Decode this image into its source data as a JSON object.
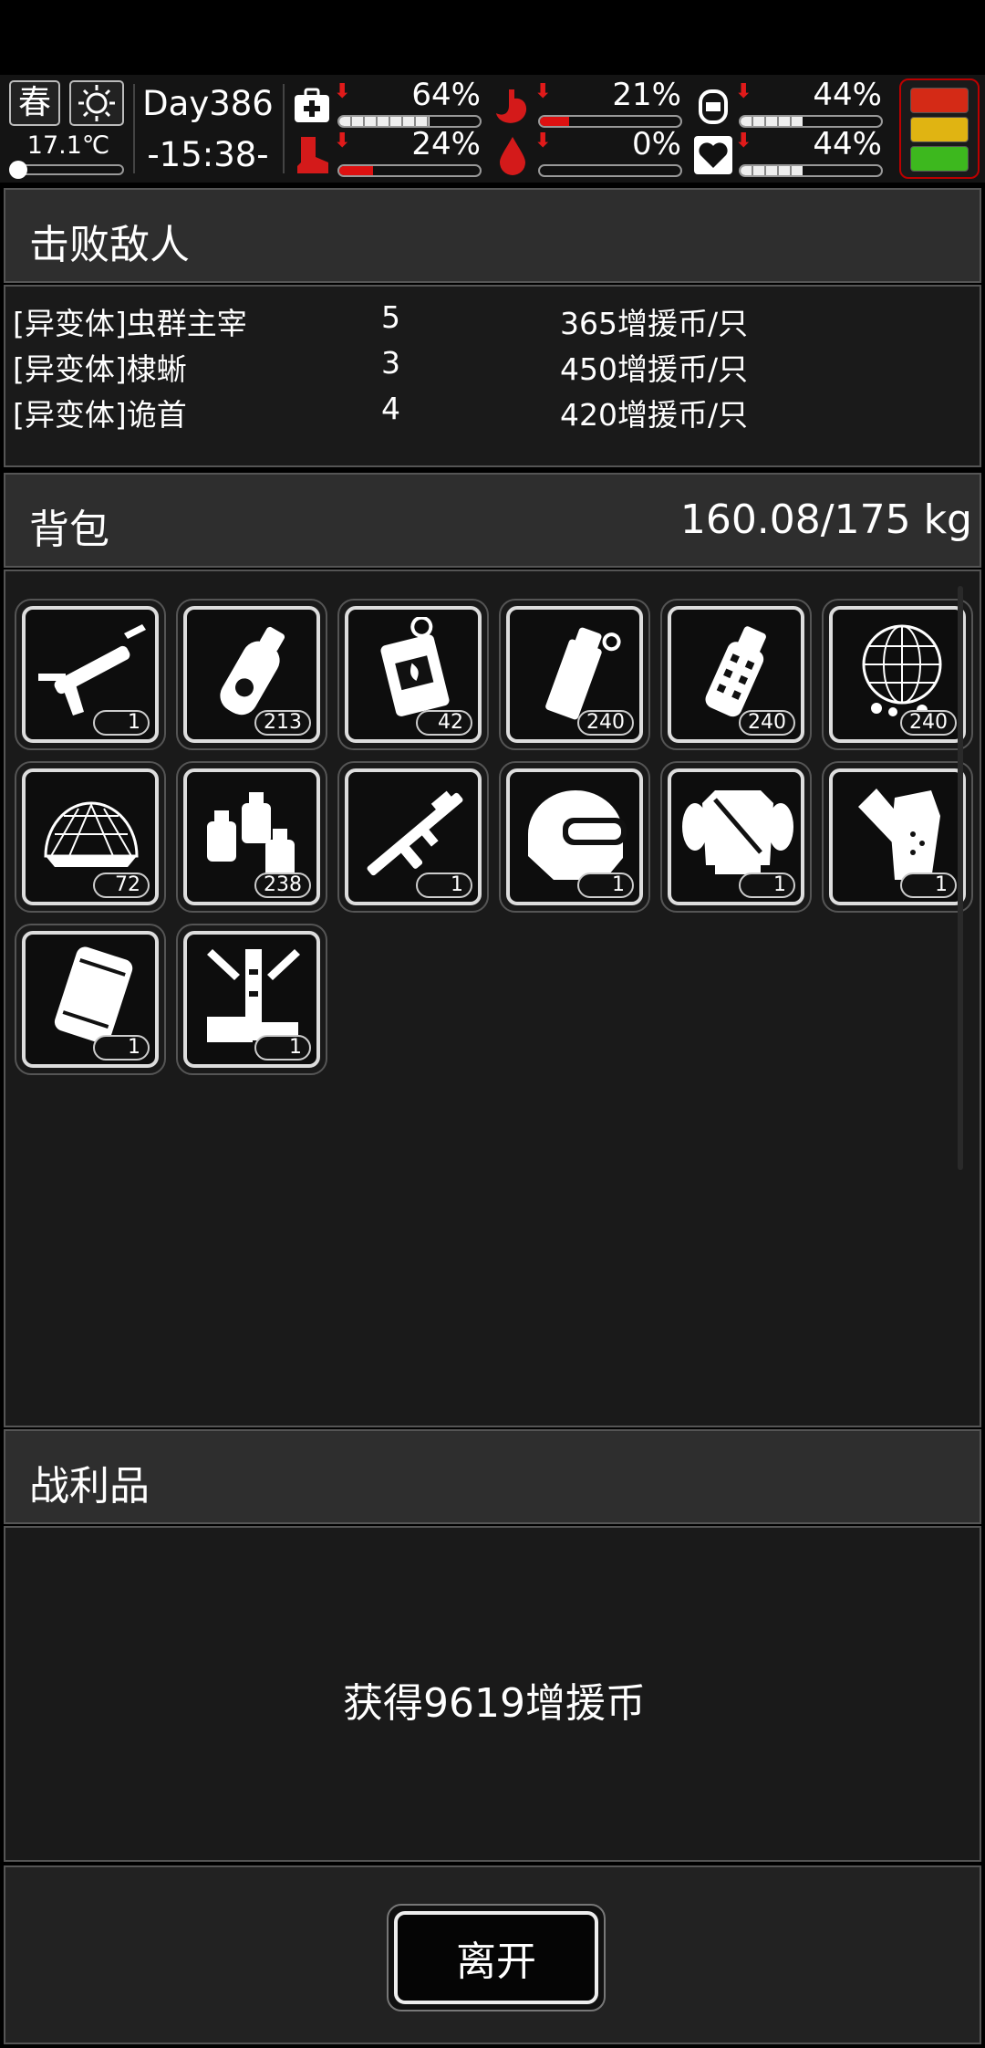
{
  "hud": {
    "season": "春",
    "weather_icon": "sun-icon",
    "temperature": "17.1℃",
    "temperature_level": 0.1,
    "day": "Day386",
    "time": "-15:38-",
    "stats": [
      {
        "name": "health",
        "icon": "first-aid-kit-icon",
        "value": "64%",
        "level": 0.64,
        "trend": "down",
        "color": "#eeeeee"
      },
      {
        "name": "hunger",
        "icon": "stomach-icon",
        "value": "21%",
        "level": 0.21,
        "trend": "down",
        "color": "#dd1111"
      },
      {
        "name": "water",
        "icon": "canteen-icon",
        "value": "44%",
        "level": 0.44,
        "trend": "down",
        "color": "#eeeeee"
      },
      {
        "name": "stamina",
        "icon": "boot-icon",
        "value": "24%",
        "level": 0.24,
        "trend": "down",
        "color": "#dd1111"
      },
      {
        "name": "blood",
        "icon": "blood-drop-icon",
        "value": "0%",
        "level": 0.0,
        "trend": "down",
        "color": "#dd1111"
      },
      {
        "name": "mood",
        "icon": "heart-icon",
        "value": "44%",
        "level": 0.44,
        "trend": "down",
        "color": "#eeeeee"
      }
    ],
    "signal_colors": [
      "#d42a16",
      "#e0b412",
      "#3db81e"
    ]
  },
  "enemies": {
    "title": "击败敌人",
    "rows": [
      {
        "name": "[异变体]虫群主宰",
        "count": "5",
        "reward": "365增援币/只"
      },
      {
        "name": "[异变体]棣蜥",
        "count": "3",
        "reward": "450增援币/只"
      },
      {
        "name": "[异变体]诡首",
        "count": "4",
        "reward": "420增援币/只"
      }
    ]
  },
  "backpack": {
    "title": "背包",
    "weight": "160.08/175 kg",
    "items": [
      {
        "icon": "caulk-gun-icon",
        "count": "1"
      },
      {
        "icon": "spray-can-icon",
        "count": "213"
      },
      {
        "icon": "incendiary-device-icon",
        "count": "42"
      },
      {
        "icon": "grenade-icon",
        "count": "240"
      },
      {
        "icon": "frag-grenade-icon",
        "count": "240"
      },
      {
        "icon": "net-mine-icon",
        "count": "240"
      },
      {
        "icon": "net-icon",
        "count": "72"
      },
      {
        "icon": "ammo-bottles-icon",
        "count": "238"
      },
      {
        "icon": "rifle-icon",
        "count": "1"
      },
      {
        "icon": "helmet-icon",
        "count": "1"
      },
      {
        "icon": "body-armor-icon",
        "count": "1"
      },
      {
        "icon": "gloves-icon",
        "count": "1"
      },
      {
        "icon": "boots-icon",
        "count": "1"
      },
      {
        "icon": "robot-arm-icon",
        "count": "1"
      }
    ]
  },
  "loot": {
    "title": "战利品",
    "text": "获得9619增援币"
  },
  "leave_button": "离开"
}
